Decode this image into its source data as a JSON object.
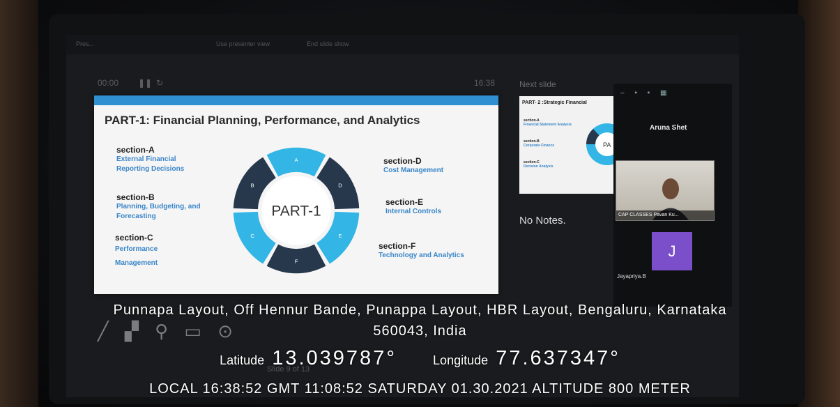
{
  "topbar": {
    "left": "Pres...",
    "middle": "Use presenter view",
    "right": "End slide show"
  },
  "presenter": {
    "timer": "00:00",
    "clock": "16:38",
    "next_slide_label": "Next slide",
    "notes_text": "No Notes.",
    "slide_counter": "Slide 9 of 13"
  },
  "current_slide": {
    "title": "PART-1: Financial Planning, Performance, and Analytics",
    "center_label": "PART-1",
    "segment_letters": [
      "A",
      "D",
      "E",
      "F",
      "C",
      "B"
    ],
    "sections": [
      {
        "name": "section-A",
        "desc": "External Financial Reporting Decisions"
      },
      {
        "name": "section-B",
        "desc": "Planning, Budgeting, and Forecasting"
      },
      {
        "name": "section-C",
        "desc": "Performance Management"
      },
      {
        "name": "section-D",
        "desc": "Cost Management"
      },
      {
        "name": "section-E",
        "desc": "Internal Controls"
      },
      {
        "name": "section-F",
        "desc": "Technology and Analytics"
      }
    ]
  },
  "next_slide": {
    "title": "PART- 2 :Strategic  Financial",
    "center_label": "PA",
    "sections": [
      {
        "name": "section-A",
        "desc": "Financial Statement Analysis"
      },
      {
        "name": "section-B",
        "desc": "Corporate Finance"
      },
      {
        "name": "section-C",
        "desc": "Decision Analysis"
      }
    ]
  },
  "participants": {
    "p1": "Aruna Shet",
    "p2": "CAP CLASSES Pavan Ku...",
    "p3_initial": "J",
    "p3": "Jayapriya.B"
  },
  "geo": {
    "address_line1": "Punnapa Layout, Off Hennur Bande, Punappa Layout, HBR Layout, Bengaluru, Karnataka",
    "address_line2": "560043, India",
    "latitude_label": "Latitude",
    "latitude": "13.039787°",
    "longitude_label": "Longitude",
    "longitude": "77.637347°",
    "bottom": "LOCAL 16:38:52  GMT 11:08:52  SATURDAY 01.30.2021  ALTITUDE 800 METER"
  },
  "colors": {
    "segment_light": "#33b5e5",
    "segment_dark": "#27384d",
    "accent": "#2f8fd0"
  }
}
